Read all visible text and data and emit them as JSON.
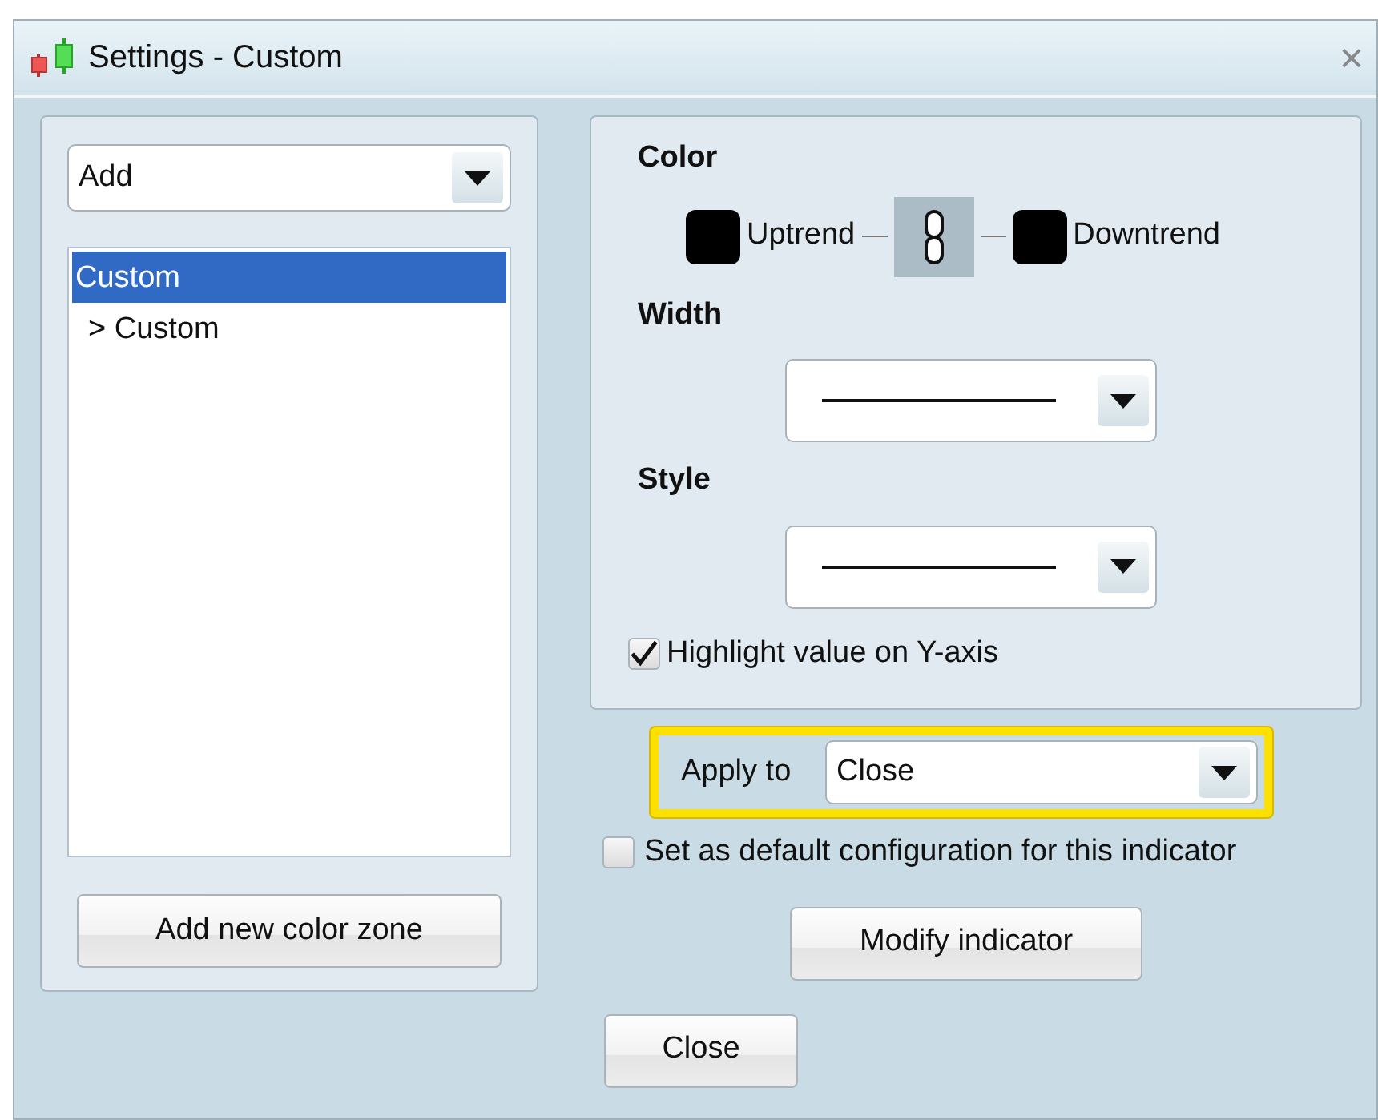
{
  "window": {
    "title": "Settings - Custom",
    "close": "×"
  },
  "left_panel": {
    "dropdown": {
      "value": "Add"
    },
    "tree": [
      {
        "label": "Custom",
        "selected": true,
        "children": [
          {
            "label": "> Custom",
            "selected": false
          }
        ]
      }
    ],
    "add_button": "Add new color zone"
  },
  "color": {
    "label": "Color",
    "uptrend": {
      "label": "Uptrend",
      "color": "#000000"
    },
    "linked": true,
    "downtrend": {
      "label": "Downtrend",
      "color": "#000000"
    }
  },
  "width": {
    "label": "Width"
  },
  "style": {
    "label": "Style"
  },
  "highlight": {
    "label": "Highlight value on Y-axis",
    "checked": true
  },
  "apply_to": {
    "label": "Apply to",
    "value": "Close",
    "highlighted": true
  },
  "default_config": {
    "label": "Set as default configuration for this indicator",
    "checked": false
  },
  "modify_button": "Modify indicator",
  "close_button": "Close"
}
